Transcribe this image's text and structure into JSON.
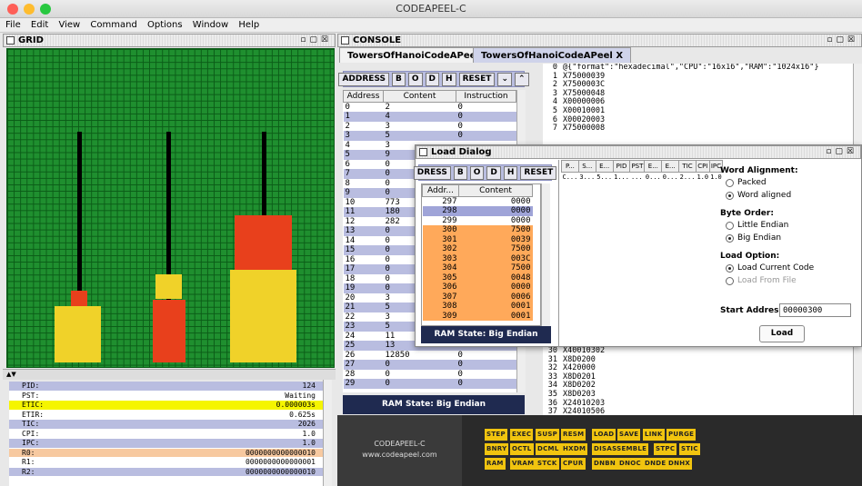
{
  "window": {
    "title": "CODEAPEEL-C"
  },
  "menu": [
    "File",
    "Edit",
    "View",
    "Command",
    "Options",
    "Window",
    "Help"
  ],
  "grid_panel": {
    "title": "GRID"
  },
  "console_panel": {
    "title": "CONSOLE"
  },
  "tabs": [
    "TowersOfHanoiCodeAPeel",
    "TowersOfHanoiCodeAPeel"
  ],
  "tab_close": "X",
  "toolbar": {
    "address": "ADDRESS",
    "b": "B",
    "o": "O",
    "d": "D",
    "h": "H",
    "reset": "RESET"
  },
  "memory_table": {
    "headers": [
      "Address",
      "Content",
      "Instruction"
    ],
    "rows": [
      [
        "0",
        "2",
        "0"
      ],
      [
        "1",
        "4",
        "0"
      ],
      [
        "2",
        "3",
        "0"
      ],
      [
        "3",
        "5",
        "0"
      ],
      [
        "4",
        "3",
        ""
      ],
      [
        "5",
        "9",
        ""
      ],
      [
        "6",
        "0",
        ""
      ],
      [
        "7",
        "0",
        ""
      ],
      [
        "8",
        "0",
        ""
      ],
      [
        "9",
        "0",
        ""
      ],
      [
        "10",
        "773",
        ""
      ],
      [
        "11",
        "180",
        ""
      ],
      [
        "12",
        "282",
        ""
      ],
      [
        "13",
        "0",
        ""
      ],
      [
        "14",
        "0",
        ""
      ],
      [
        "15",
        "0",
        ""
      ],
      [
        "16",
        "0",
        ""
      ],
      [
        "17",
        "0",
        ""
      ],
      [
        "18",
        "0",
        ""
      ],
      [
        "19",
        "0",
        ""
      ],
      [
        "20",
        "3",
        ""
      ],
      [
        "21",
        "5",
        ""
      ],
      [
        "22",
        "3",
        ""
      ],
      [
        "23",
        "5",
        ""
      ],
      [
        "24",
        "11",
        ""
      ],
      [
        "25",
        "13",
        "0"
      ],
      [
        "26",
        "12850",
        "0"
      ],
      [
        "27",
        "0",
        "0"
      ],
      [
        "28",
        "0",
        "0"
      ],
      [
        "29",
        "0",
        "0"
      ]
    ]
  },
  "ram_state": "RAM State: Big Endian",
  "registers": [
    {
      "name": "PID:",
      "value": "124",
      "color": "#b9bde0"
    },
    {
      "name": "PST:",
      "value": "Waiting",
      "color": "#ffffff"
    },
    {
      "name": "ETIC:",
      "value": "0.000003s",
      "color": "#f5f500"
    },
    {
      "name": "ETIR:",
      "value": "0.625s",
      "color": "#ffffff"
    },
    {
      "name": "TIC:",
      "value": "2026",
      "color": "#b9bde0"
    },
    {
      "name": "CPI:",
      "value": "1.0",
      "color": "#ffffff"
    },
    {
      "name": "IPC:",
      "value": "1.0",
      "color": "#b9bde0"
    },
    {
      "name": "R0:",
      "value": "0000000000000010",
      "color": "#f7c9a0"
    },
    {
      "name": "R1:",
      "value": "0000000000000001",
      "color": "#ffffff"
    },
    {
      "name": "R2:",
      "value": "0000000000000010",
      "color": "#b9bde0"
    }
  ],
  "console_lines": [
    {
      "n": "0",
      "t": "@{\"format\":\"hexadecimal\",\"CPU\":\"16x16\",\"RAM\":\"1024x16\"}"
    },
    {
      "n": "1",
      "t": "X75000039"
    },
    {
      "n": "2",
      "t": "X7500003C"
    },
    {
      "n": "3",
      "t": "X75000048"
    },
    {
      "n": "4",
      "t": "X00000006"
    },
    {
      "n": "5",
      "t": "X00010001"
    },
    {
      "n": "6",
      "t": "X00020003"
    },
    {
      "n": "7",
      "t": "X75000008"
    }
  ],
  "console_lines_bottom": [
    {
      "n": "30",
      "t": "X40010302"
    },
    {
      "n": "31",
      "t": "X8D0200"
    },
    {
      "n": "32",
      "t": "X420000"
    },
    {
      "n": "33",
      "t": "X8D0201"
    },
    {
      "n": "34",
      "t": "X8D0202"
    },
    {
      "n": "35",
      "t": "X8D0203"
    },
    {
      "n": "36",
      "t": "X24010203"
    },
    {
      "n": "37",
      "t": "X24010506"
    }
  ],
  "load_dialog": {
    "title": "Load Dialog",
    "toolbar": {
      "address": "DRESS",
      "b": "B",
      "o": "O",
      "d": "D",
      "h": "H",
      "reset": "RESET"
    },
    "headers": [
      "Addr...",
      "Content"
    ],
    "rows": [
      {
        "a": "297",
        "c": "0000",
        "hl": "none"
      },
      {
        "a": "298",
        "c": "0000",
        "hl": "sel"
      },
      {
        "a": "299",
        "c": "0000",
        "hl": "none"
      },
      {
        "a": "300",
        "c": "7500",
        "hl": "or"
      },
      {
        "a": "301",
        "c": "0039",
        "hl": "or"
      },
      {
        "a": "302",
        "c": "7500",
        "hl": "or"
      },
      {
        "a": "303",
        "c": "003C",
        "hl": "or"
      },
      {
        "a": "304",
        "c": "7500",
        "hl": "or"
      },
      {
        "a": "305",
        "c": "0048",
        "hl": "or"
      },
      {
        "a": "306",
        "c": "0000",
        "hl": "or"
      },
      {
        "a": "307",
        "c": "0006",
        "hl": "or"
      },
      {
        "a": "308",
        "c": "0001",
        "hl": "or"
      },
      {
        "a": "309",
        "c": "0001",
        "hl": "or"
      }
    ],
    "ram_state": "RAM State: Big Endian",
    "proc_headers": [
      "P...",
      "S...",
      "E...",
      "PID",
      "PST",
      "E...",
      "E...",
      "TIC",
      "CPI",
      "IPC"
    ],
    "proc_row": [
      "C...",
      "3...",
      "5...",
      "1...",
      "...",
      "0...",
      "0...",
      "2...",
      "1.0",
      "1.0"
    ],
    "word_alignment": "Word Alignment:",
    "packed": "Packed",
    "word_aligned": "Word aligned",
    "byte_order": "Byte Order:",
    "little_endian": "Little Endian",
    "big_endian": "Big Endian",
    "load_option": "Load Option:",
    "load_current": "Load Current Code",
    "load_file": "Load From File",
    "start_address_label": "Start Address:",
    "start_address": "00000300",
    "load_button": "Load"
  },
  "brand": {
    "name": "CODEAPEEL-C",
    "url": "www.codeapeel.com"
  },
  "commands": [
    [
      "STEP",
      "EXEC",
      "SUSP",
      "RESM",
      "LOAD",
      "SAVE",
      "LINK",
      "PURGE"
    ],
    [
      "BNRY",
      "OCTL",
      "DCML",
      "HXDM",
      "DISASSEMBLE",
      "STPC",
      "STIC"
    ],
    [
      "RAM",
      "VRAM",
      "STCK",
      "CPUR",
      "DNBN",
      "DNOC",
      "DNDE",
      "DNHX"
    ]
  ],
  "colors": {
    "grid": "#1f8f2f",
    "disk_red": "#e8401c",
    "disk_yellow": "#f0d229",
    "highlight": "#ffa95a",
    "accent": "#b9bde0"
  }
}
